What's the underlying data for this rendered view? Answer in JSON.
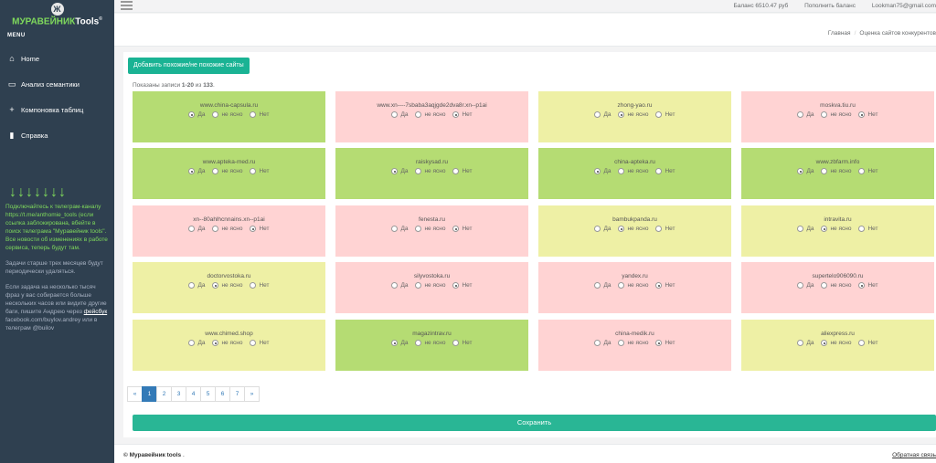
{
  "sidebar": {
    "logo_glyph": "Ж",
    "brand_a": "МУРАВЕЙНИК",
    "brand_b": "Tools",
    "brand_sup": "©",
    "menu_label": "MENU",
    "items": [
      {
        "label": "Home",
        "icon": "home-icon",
        "glyph": "⌂"
      },
      {
        "label": "Анализ семантики",
        "icon": "monitor-icon",
        "glyph": "▭"
      },
      {
        "label": "Компоновка таблиц",
        "icon": "plus-icon",
        "glyph": "+"
      },
      {
        "label": "Справка",
        "icon": "book-icon",
        "glyph": "▮"
      }
    ],
    "arrows": "↓↓↓↓↓↓↓",
    "promo": "Подключайтесь к телеграм-каналу https://t.me/anthomie_tools (если ссылка заблокирована, вбейте в поиск телеграма \"Муравейник tools\". Все новости об изменениях в работе сервиса, теперь будут там.",
    "note1": "Задачи старше трех месяцев будут периодически удаляться.",
    "note2": "Если задача на несколько тысяч фраз у вас собирается больше нескольких часов или видите другие баги, пишите Андрею через",
    "note2_link": "фейсбук",
    "note2_tail": "facebook.com/buylov.andrey или в телеграм @builov"
  },
  "topbar": {
    "balance": "Баланс 6510.47 руб",
    "topup": "Пополнить баланс",
    "email": "Lookman75@gmail.com"
  },
  "breadcrumb": {
    "home": "Главная",
    "sep": "/",
    "current": "Оценка сайтов конкурентов"
  },
  "main": {
    "add_button": "Добавить похожие/не похожие сайты",
    "shown_prefix": "Показаны записи",
    "shown_range": "1-20",
    "shown_mid": "из",
    "shown_total": "133",
    "shown_end": ".",
    "option_labels": [
      "Да",
      "не ясно",
      "Нет"
    ],
    "sites": [
      {
        "name": "www.china-capsula.ru",
        "selected": 0,
        "color": "green"
      },
      {
        "name": "www.xn----7sbaba3aqjgde2dva8r.xn--p1ai",
        "selected": 2,
        "color": "pink"
      },
      {
        "name": "zhong-yao.ru",
        "selected": 1,
        "color": "yellow"
      },
      {
        "name": "moskva.tiu.ru",
        "selected": 2,
        "color": "pink"
      },
      {
        "name": "www.apteka-med.ru",
        "selected": 0,
        "color": "green"
      },
      {
        "name": "raiskysad.ru",
        "selected": 0,
        "color": "green"
      },
      {
        "name": "china-apteka.ru",
        "selected": 0,
        "color": "green"
      },
      {
        "name": "www.zbfarm.info",
        "selected": 0,
        "color": "green"
      },
      {
        "name": "xn--80ahlhcnnains.xn--p1ai",
        "selected": 2,
        "color": "pink"
      },
      {
        "name": "fenesta.ru",
        "selected": 2,
        "color": "pink"
      },
      {
        "name": "bambukpanda.ru",
        "selected": 1,
        "color": "yellow"
      },
      {
        "name": "intravita.ru",
        "selected": 1,
        "color": "yellow"
      },
      {
        "name": "doctorvostoka.ru",
        "selected": 1,
        "color": "yellow"
      },
      {
        "name": "silyvostoka.ru",
        "selected": 2,
        "color": "pink"
      },
      {
        "name": "yandex.ru",
        "selected": 2,
        "color": "pink"
      },
      {
        "name": "supertelo906090.ru",
        "selected": 2,
        "color": "pink"
      },
      {
        "name": "www.chimed.shop",
        "selected": 1,
        "color": "yellow"
      },
      {
        "name": "magazintrav.ru",
        "selected": 0,
        "color": "green"
      },
      {
        "name": "china-medik.ru",
        "selected": 2,
        "color": "pink"
      },
      {
        "name": "aliexpress.ru",
        "selected": 1,
        "color": "yellow"
      }
    ],
    "pagination": [
      "«",
      "1",
      "2",
      "3",
      "4",
      "5",
      "6",
      "7",
      "»"
    ],
    "active_page": "1",
    "save_button": "Сохранить"
  },
  "footer": {
    "copyright": "© Муравейник tools",
    "copyright_tail": ".",
    "feedback": "Обратная связь"
  },
  "colors": {
    "sidebar_bg": "#2f4050",
    "accent": "#1ab394",
    "green": "#b5dc73",
    "pink": "#ffd3d3",
    "yellow": "#eef0a5",
    "page_active": "#337ab7"
  }
}
